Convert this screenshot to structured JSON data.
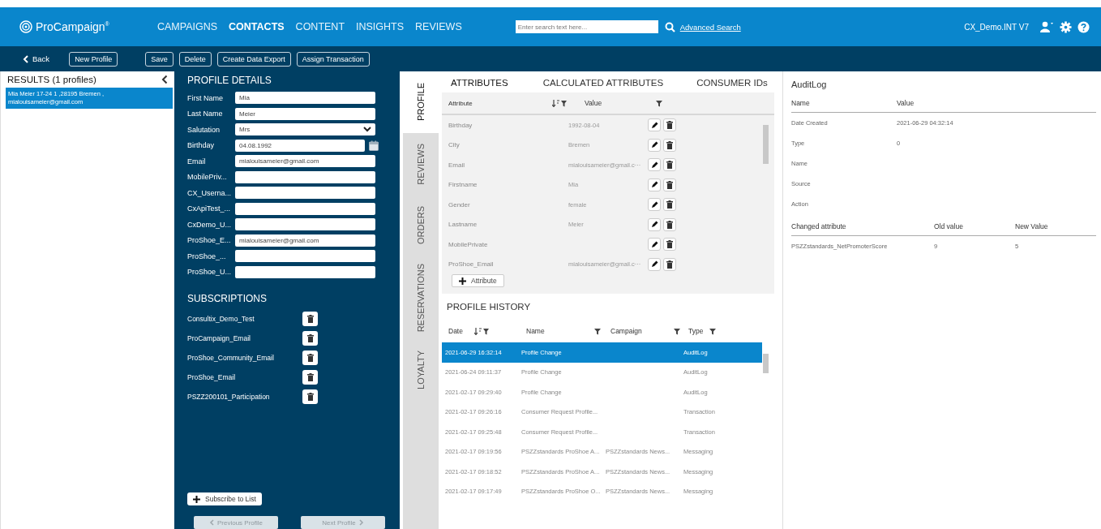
{
  "app": {
    "logo": "ProCampaign",
    "logo_mark": "®"
  },
  "nav": [
    {
      "label": "CAMPAIGNS",
      "selected": false
    },
    {
      "label": "CONTACTS",
      "selected": true
    },
    {
      "label": "CONTENT",
      "selected": false
    },
    {
      "label": "INSIGHTS",
      "selected": false
    },
    {
      "label": "REVIEWS",
      "selected": false
    }
  ],
  "search": {
    "placeholder": "Enter search text here...",
    "advanced": "Advanced Search"
  },
  "account": {
    "name": "CX_Demo.INT V7"
  },
  "toolbar": {
    "back": "Back",
    "left_buttons": [
      "New Profile"
    ],
    "buttons": [
      "Save",
      "Delete",
      "Create Data Export",
      "Assign Transaction"
    ]
  },
  "results": {
    "title": "RESULTS (1 profiles)",
    "items": [
      {
        "line1": "Mia Meier 17-24 1 ,28195 Bremen ,",
        "line2": "mialouisameier@gmail.com",
        "selected": true
      }
    ]
  },
  "profile_details": {
    "title": "PROFILE DETAILS",
    "fields": [
      {
        "label": "First Name",
        "value": "Mia",
        "kind": "text"
      },
      {
        "label": "Last Name",
        "value": "Meier",
        "kind": "text"
      },
      {
        "label": "Salutation",
        "value": "Mrs",
        "kind": "select"
      },
      {
        "label": "Birthday",
        "value": "04.08.1992",
        "kind": "date"
      },
      {
        "label": "Email",
        "value": "mialouisameier@gmail.com",
        "kind": "text"
      },
      {
        "label": "MobilePriv...",
        "kind": "text"
      },
      {
        "label": "CX_Userna...",
        "kind": "text"
      },
      {
        "label": "CxApiTest_...",
        "kind": "text"
      },
      {
        "label": "CxDemo_U...",
        "kind": "text"
      },
      {
        "label": "ProShoe_E...",
        "value": "mialouisameier@gmail.com",
        "kind": "text"
      },
      {
        "label": "ProShoe_...",
        "kind": "text"
      },
      {
        "label": "ProShoe_U...",
        "kind": "text"
      }
    ]
  },
  "subscriptions": {
    "title": "SUBSCRIPTIONS",
    "items": [
      "Consultix_Demo_Test",
      "ProCampaign_Email",
      "ProShoe_Community_Email",
      "ProShoe_Email",
      "PSZZ200101_Participation"
    ],
    "subscribe_button": "Subscribe to List"
  },
  "pager": {
    "previous": "Previous Profile",
    "next": "Next Profile"
  },
  "side_tabs": [
    {
      "label": "PROFILE",
      "selected": true
    },
    {
      "label": "REVIEWS",
      "selected": false
    },
    {
      "label": "ORDERS",
      "selected": false
    },
    {
      "label": "RESERVATIONS",
      "selected": false
    },
    {
      "label": "LOYALTY",
      "selected": false
    }
  ],
  "attribute_tabs": [
    {
      "label": "ATTRIBUTES",
      "selected": true
    },
    {
      "label": "CALCULATED ATTRIBUTES",
      "selected": false
    },
    {
      "label": "CONSUMER IDs",
      "selected": false
    }
  ],
  "attributes": {
    "columns": [
      "Attribute",
      "Value"
    ],
    "rows": [
      {
        "attribute": "Birthday",
        "value": "1992-08-04"
      },
      {
        "attribute": "City",
        "value": "Bremen"
      },
      {
        "attribute": "Email",
        "value": "mialouisameier@gmail.c···"
      },
      {
        "attribute": "Firstname",
        "value": "Mia"
      },
      {
        "attribute": "Gender",
        "value": "female"
      },
      {
        "attribute": "Lastname",
        "value": "Meier"
      },
      {
        "attribute": "MobilePrivate"
      },
      {
        "attribute": "ProShoe_Email",
        "value": "mialouisameier@gmail.c···"
      }
    ],
    "add_button": "Attribute"
  },
  "profile_history": {
    "title": "PROFILE HISTORY",
    "columns": [
      "Date",
      "Name",
      "Campaign",
      "Type"
    ],
    "rows": [
      {
        "date": "2021-06-29 16:32:14",
        "name": "Profile Change",
        "type": "AuditLog",
        "selected": true
      },
      {
        "date": "2021-06-24 09:11:37",
        "name": "Profile Change",
        "type": "AuditLog",
        "selected": false
      },
      {
        "date": "2021-02-17 09:29:40",
        "name": "Profile Change",
        "type": "AuditLog",
        "selected": false
      },
      {
        "date": "2021-02-17 09:26:16",
        "name": "Consumer Request Profile...",
        "type": "Transaction",
        "selected": false
      },
      {
        "date": "2021-02-17 09:25:48",
        "name": "Consumer Request Profile...",
        "type": "Transaction",
        "selected": false
      },
      {
        "date": "2021-02-17 09:19:56",
        "name": "PSZZstandards ProShoe A...",
        "campaign": "PSZZstandards News...",
        "type": "Messaging",
        "selected": false
      },
      {
        "date": "2021-02-17 09:18:52",
        "name": "PSZZstandards ProShoe A...",
        "campaign": "PSZZstandards News...",
        "type": "Messaging",
        "selected": false
      },
      {
        "date": "2021-02-17 09:17:49",
        "name": "PSZZstandards ProShoe O...",
        "campaign": "PSZZstandards News...",
        "type": "Messaging",
        "selected": false
      }
    ]
  },
  "audit_log": {
    "title": "AuditLog",
    "columns": [
      "Name",
      "Value"
    ],
    "rows": [
      {
        "name": "Date Created",
        "value": "2021-06-29 04:32:14"
      },
      {
        "name": "Type",
        "value": "0"
      },
      {
        "name": "Name"
      },
      {
        "name": "Source"
      },
      {
        "name": "Action"
      }
    ],
    "change_columns": [
      "Changed attribute",
      "Old value",
      "New Value"
    ],
    "changes": [
      {
        "attribute": "PSZZstandards_NetPromoterScore",
        "old": "9",
        "new": "5"
      }
    ]
  }
}
